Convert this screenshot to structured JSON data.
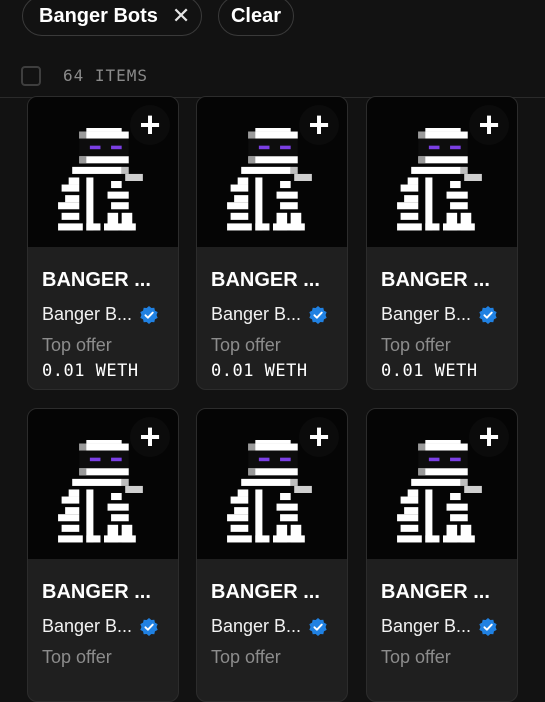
{
  "filters": {
    "chip_label": "Banger Bots",
    "clear_label": "Clear"
  },
  "toolbar": {
    "items_count": "64 ITEMS"
  },
  "cards": [
    {
      "name": "BANGER ...",
      "collection": "Banger B...",
      "offer_label": "Top offer",
      "offer_value": "0.01 WETH"
    },
    {
      "name": "BANGER ...",
      "collection": "Banger B...",
      "offer_label": "Top offer",
      "offer_value": "0.01 WETH"
    },
    {
      "name": "BANGER ...",
      "collection": "Banger B...",
      "offer_label": "Top offer",
      "offer_value": "0.01 WETH"
    },
    {
      "name": "BANGER ...",
      "collection": "Banger B...",
      "offer_label": "Top offer",
      "offer_value": ""
    },
    {
      "name": "BANGER ...",
      "collection": "Banger B...",
      "offer_label": "Top offer",
      "offer_value": ""
    },
    {
      "name": "BANGER ...",
      "collection": "Banger B...",
      "offer_label": "Top offer",
      "offer_value": ""
    }
  ],
  "colors": {
    "background": "#121212",
    "card": "#1f1f1f",
    "verified": "#2081e2",
    "robot_eyes": "#7b3fe4"
  }
}
